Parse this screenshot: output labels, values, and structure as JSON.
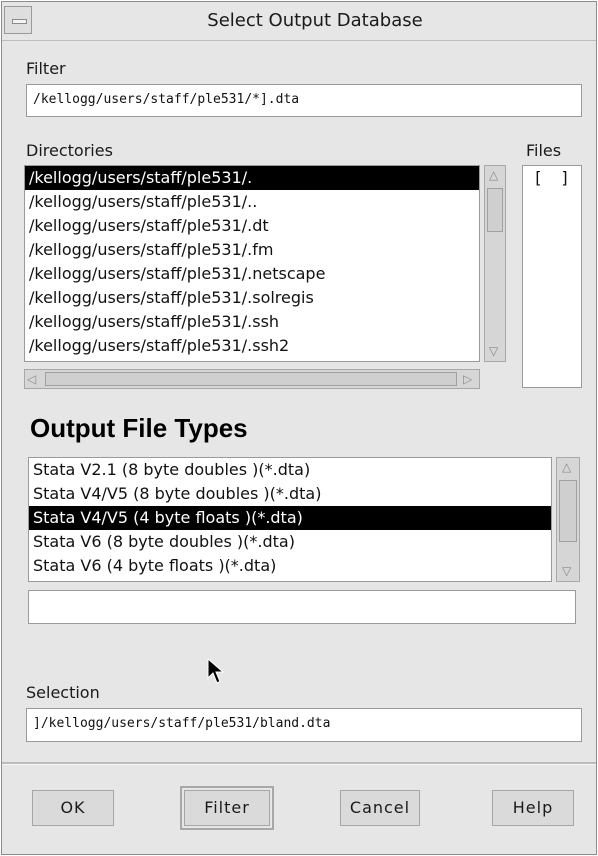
{
  "window": {
    "title": "Select Output Database"
  },
  "filter": {
    "label": "Filter",
    "value": "/kellogg/users/staff/ple531/*].dta"
  },
  "directories": {
    "label": "Directories",
    "items": [
      "/kellogg/users/staff/ple531/.",
      "/kellogg/users/staff/ple531/..",
      "/kellogg/users/staff/ple531/.dt",
      "/kellogg/users/staff/ple531/.fm",
      "/kellogg/users/staff/ple531/.netscape",
      "/kellogg/users/staff/ple531/.solregis",
      "/kellogg/users/staff/ple531/.ssh",
      "/kellogg/users/staff/ple531/.ssh2"
    ],
    "selected_index": 0
  },
  "files": {
    "label": "Files",
    "items": [
      "[ ]"
    ]
  },
  "output_types": {
    "heading": "Output File Types",
    "items": [
      "Stata V2.1 (8 byte doubles )(*.dta)",
      "Stata V4/V5 (8 byte doubles )(*.dta)",
      "Stata V4/V5 (4 byte floats )(*.dta)",
      "Stata V6 (8 byte doubles )(*.dta)",
      "Stata V6 (4 byte floats )(*.dta)"
    ],
    "selected_index": 2,
    "extra_value": ""
  },
  "selection": {
    "label": "Selection",
    "value": "]/kellogg/users/staff/ple531/bland.dta"
  },
  "buttons": {
    "ok": "OK",
    "filter": "Filter",
    "cancel": "Cancel",
    "help": "Help"
  },
  "colors": {
    "background": "#e6e6e6",
    "selection": "#000000"
  },
  "icons": {
    "window_menu": "window-menu-icon",
    "scroll_up": "arrow-up-icon",
    "scroll_down": "arrow-down-icon",
    "scroll_left": "arrow-left-icon",
    "scroll_right": "arrow-right-icon",
    "pointer": "mouse-pointer-icon"
  }
}
